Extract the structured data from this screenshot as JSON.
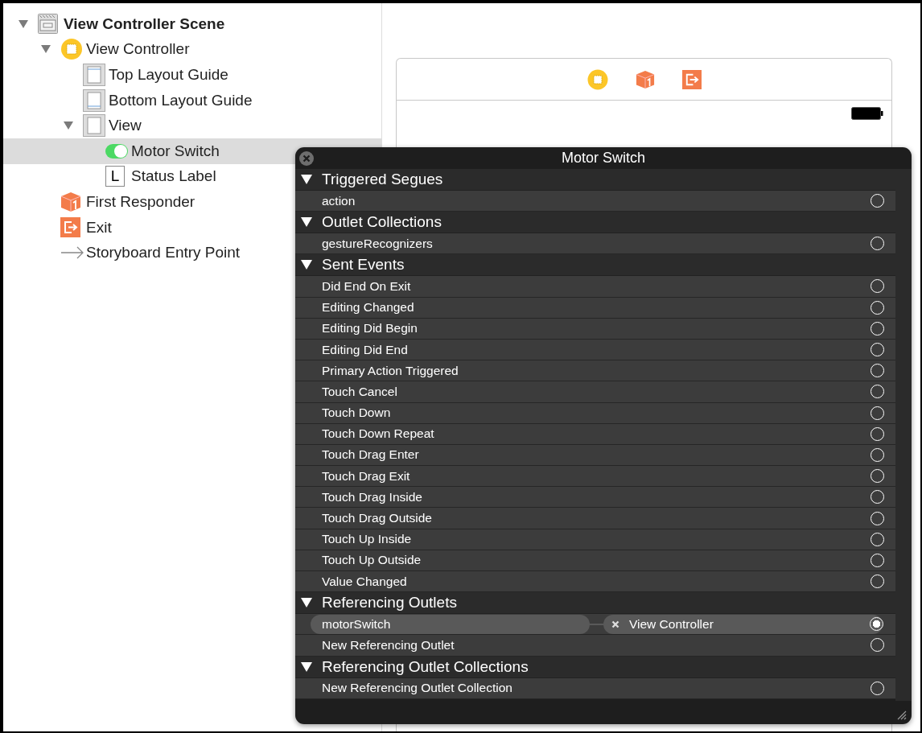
{
  "outline": [
    {
      "kind": "scene",
      "title": "View Controller Scene",
      "expanded": true,
      "selected": false,
      "children": [
        {
          "kind": "view-controller",
          "title": "View Controller",
          "expanded": true,
          "selected": false,
          "children": [
            {
              "kind": "top-guide",
              "title": "Top Layout Guide",
              "selected": false
            },
            {
              "kind": "bottom-guide",
              "title": "Bottom Layout Guide",
              "selected": false
            },
            {
              "kind": "view",
              "title": "View",
              "expanded": true,
              "selected": false,
              "children": [
                {
                  "kind": "switch",
                  "title": "Motor Switch",
                  "selected": true
                },
                {
                  "kind": "label",
                  "title": "Status Label",
                  "selected": false
                }
              ]
            }
          ]
        },
        {
          "kind": "first-responder",
          "title": "First Responder",
          "selected": false
        },
        {
          "kind": "exit",
          "title": "Exit",
          "selected": false
        },
        {
          "kind": "entry-point",
          "title": "Storyboard Entry Point",
          "selected": false
        }
      ]
    }
  ],
  "label_glyph": "L",
  "connections_panel": {
    "title": "Motor Switch",
    "sections": [
      {
        "title": "Triggered Segues",
        "expanded": true,
        "rows": [
          {
            "name": "action",
            "connected": false
          }
        ]
      },
      {
        "title": "Outlet Collections",
        "expanded": true,
        "rows": [
          {
            "name": "gestureRecognizers",
            "connected": false
          }
        ]
      },
      {
        "title": "Sent Events",
        "expanded": true,
        "rows": [
          {
            "name": "Did End On Exit",
            "connected": false
          },
          {
            "name": "Editing Changed",
            "connected": false
          },
          {
            "name": "Editing Did Begin",
            "connected": false
          },
          {
            "name": "Editing Did End",
            "connected": false
          },
          {
            "name": "Primary Action Triggered",
            "connected": false
          },
          {
            "name": "Touch Cancel",
            "connected": false
          },
          {
            "name": "Touch Down",
            "connected": false
          },
          {
            "name": "Touch Down Repeat",
            "connected": false
          },
          {
            "name": "Touch Drag Enter",
            "connected": false
          },
          {
            "name": "Touch Drag Exit",
            "connected": false
          },
          {
            "name": "Touch Drag Inside",
            "connected": false
          },
          {
            "name": "Touch Drag Outside",
            "connected": false
          },
          {
            "name": "Touch Up Inside",
            "connected": false
          },
          {
            "name": "Touch Up Outside",
            "connected": false
          },
          {
            "name": "Value Changed",
            "connected": false
          }
        ]
      },
      {
        "title": "Referencing Outlets",
        "expanded": true,
        "rows": [
          {
            "name": "motorSwitch",
            "connected": true,
            "target": "View Controller"
          },
          {
            "name": "New Referencing Outlet",
            "connected": false
          }
        ]
      },
      {
        "title": "Referencing Outlet Collections",
        "expanded": true,
        "rows": [
          {
            "name": "New Referencing Outlet Collection",
            "connected": false
          }
        ]
      }
    ]
  }
}
